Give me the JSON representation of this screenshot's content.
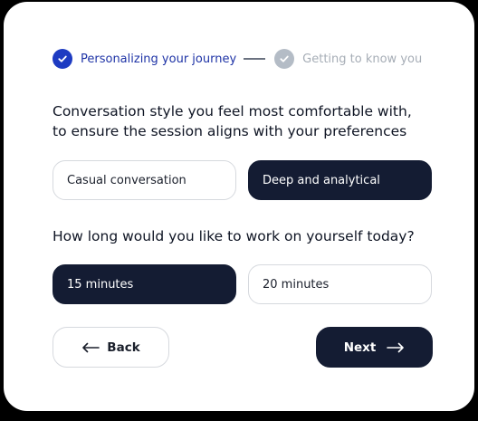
{
  "stepper": {
    "step1_label": "Personalizing your journey",
    "step2_label": "Getting to know you"
  },
  "questions": {
    "style_line1": "Conversation style you feel most comfortable with,",
    "style_line2": "to ensure the session aligns with your preferences",
    "duration": "How long would you like to work on yourself today?"
  },
  "options": {
    "style": [
      {
        "label": "Casual conversation",
        "selected": false
      },
      {
        "label": "Deep and analytical",
        "selected": true
      }
    ],
    "duration": [
      {
        "label": "15 minutes",
        "selected": true
      },
      {
        "label": "20 minutes",
        "selected": false
      }
    ]
  },
  "buttons": {
    "back_label": "Back",
    "next_label": "Next"
  },
  "icons": {
    "step1": "check-circle-icon",
    "step2": "check-badge-icon",
    "back": "arrow-left-icon",
    "next": "arrow-right-icon"
  },
  "colors": {
    "accent_blue": "#1d3bc2",
    "dark_navy": "#141c33",
    "inactive_gray": "#a6adb6"
  }
}
